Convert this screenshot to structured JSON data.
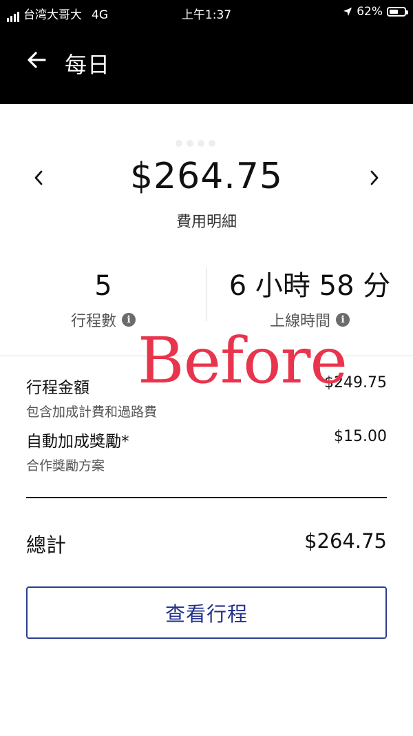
{
  "status_bar": {
    "carrier": "台湾大哥大",
    "network": "4G",
    "time": "上午1:37",
    "battery": "62%",
    "battery_level": 0.62
  },
  "header": {
    "title": "每日"
  },
  "summary": {
    "amount": "$264.75",
    "breakdown_label": "費用明細"
  },
  "stats": {
    "trips_value": "5",
    "trips_label": "行程數",
    "online_value": "6 小時 58 分",
    "online_label": "上線時間"
  },
  "watermark": "Before",
  "earnings": {
    "fare_label": "行程金額",
    "fare_value": "$249.75",
    "fare_sub": "包含加成計費和過路費",
    "promo_label": "自動加成獎勵*",
    "promo_value": "$15.00",
    "promo_sub": "合作獎勵方案",
    "total_label": "總計",
    "total_value": "$264.75"
  },
  "actions": {
    "view_trips": "查看行程"
  },
  "colors": {
    "header_bg": "#000000",
    "accent": "#22318a",
    "watermark": "#e8344c"
  }
}
